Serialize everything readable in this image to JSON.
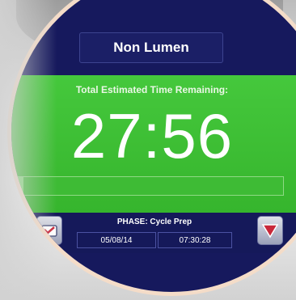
{
  "screen": {
    "cycle_name": "Non Lumen",
    "time_label": "Total Estimated Time Remaining:",
    "time_remaining": "27:56",
    "progress": 0.02,
    "phase": "PHASE: Cycle Prep",
    "date": "05/08/14",
    "clock": "07:30:28"
  },
  "icons": {
    "left_button": "tray-icon",
    "right_button": "stop-icon"
  },
  "colors": {
    "panel_green": "#3fc036",
    "screen_navy": "#16195d",
    "stop_red": "#c8283a"
  }
}
